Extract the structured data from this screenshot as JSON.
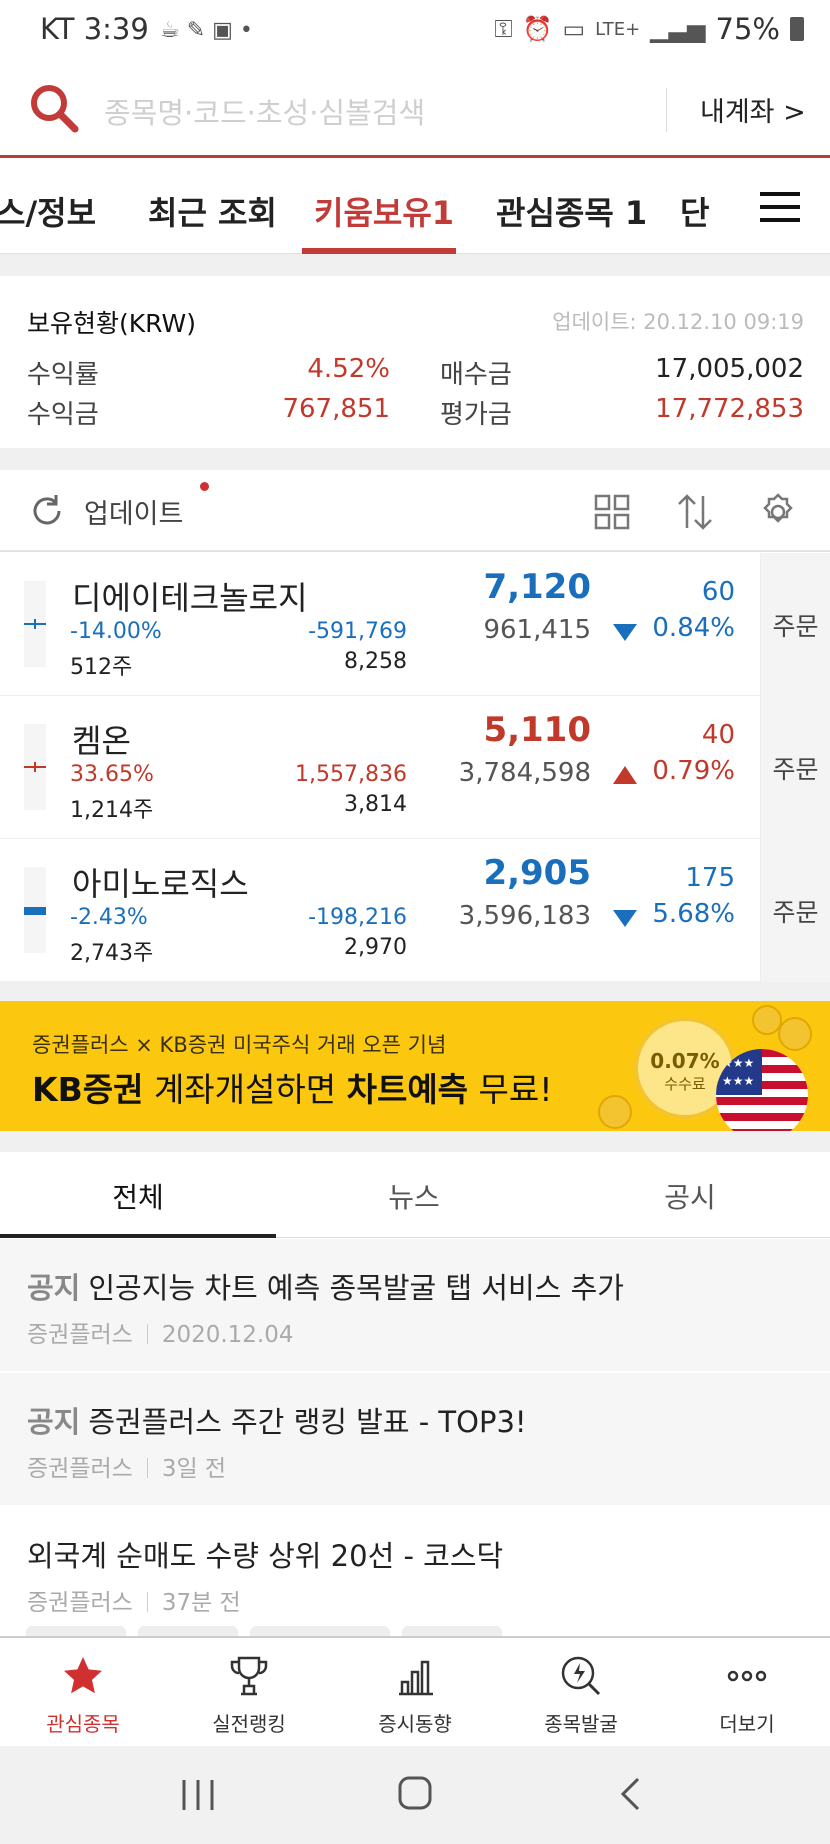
{
  "status_bar": {
    "carrier_time": "KT 3:39",
    "battery": "75%",
    "network": "LTE+"
  },
  "search": {
    "placeholder": "종목명·코드·초성·심볼검색",
    "account_link": "내계좌 >"
  },
  "tabs": [
    {
      "label": "스/정보"
    },
    {
      "label": "최근 조회"
    },
    {
      "label": "키움보유1",
      "active": true
    },
    {
      "label": "관심종목 1"
    },
    {
      "label": "단"
    }
  ],
  "holdings": {
    "title": "보유현황(KRW)",
    "updated": "업데이트: 20.12.10 09:19",
    "return_rate_label": "수익률",
    "return_rate": "4.52%",
    "profit_label": "수익금",
    "profit": "767,851",
    "purchase_label": "매수금",
    "purchase": "17,005,002",
    "valuation_label": "평가금",
    "valuation": "17,772,853"
  },
  "toolbar": {
    "update_label": "업데이트"
  },
  "stocks": [
    {
      "name": "디에이테크놀로지",
      "rate": "-14.00%",
      "qty": "512주",
      "pnl": "-591,769",
      "cnt": "8,258",
      "price": "7,120",
      "volume": "961,415",
      "change": "60",
      "change_pct": "0.84%",
      "direction": "down",
      "order": "주문"
    },
    {
      "name": "켐온",
      "rate": "33.65%",
      "qty": "1,214주",
      "pnl": "1,557,836",
      "cnt": "3,814",
      "price": "5,110",
      "volume": "3,784,598",
      "change": "40",
      "change_pct": "0.79%",
      "direction": "up",
      "order": "주문"
    },
    {
      "name": "아미노로직스",
      "rate": "-2.43%",
      "qty": "2,743주",
      "pnl": "-198,216",
      "cnt": "2,970",
      "price": "2,905",
      "volume": "3,596,183",
      "change": "175",
      "change_pct": "5.68%",
      "direction": "down",
      "order": "주문"
    }
  ],
  "banner": {
    "subtitle": "증권플러스 × KB증권 미국주식 거래 오픈 기념",
    "title_a": "KB증권",
    "title_b": " 계좌개설하면 ",
    "title_c": "차트예측",
    "title_d": " 무료!",
    "coin_pct": "0.07%",
    "coin_label": "수수료"
  },
  "news_tabs": [
    {
      "label": "전체",
      "active": true
    },
    {
      "label": "뉴스"
    },
    {
      "label": "공시"
    }
  ],
  "news": [
    {
      "tag": "공지",
      "title": "인공지능 차트 예측 종목발굴 탭 서비스 추가",
      "source": "증권플러스",
      "time": "2020.12.04"
    },
    {
      "tag": "공지",
      "title": "증권플러스 주간 랭킹 발표 - TOP3!",
      "source": "증권플러스",
      "time": "3일 전"
    },
    {
      "tag": "",
      "title": "외국계 순매도 수량 상위 20선 - 코스닥",
      "source": "증권플러스",
      "time": "37분 전"
    }
  ],
  "bottom_nav": [
    {
      "label": "관심종목",
      "icon": "star-icon",
      "active": true
    },
    {
      "label": "실전랭킹",
      "icon": "trophy-icon"
    },
    {
      "label": "증시동향",
      "icon": "bar-chart-icon"
    },
    {
      "label": "종목발굴",
      "icon": "discover-icon"
    },
    {
      "label": "더보기",
      "icon": "more-icon"
    }
  ],
  "colors": {
    "accent": "#c23b38",
    "up": "#c0392b",
    "down": "#1a6fbd",
    "banner": "#fcc80f"
  }
}
